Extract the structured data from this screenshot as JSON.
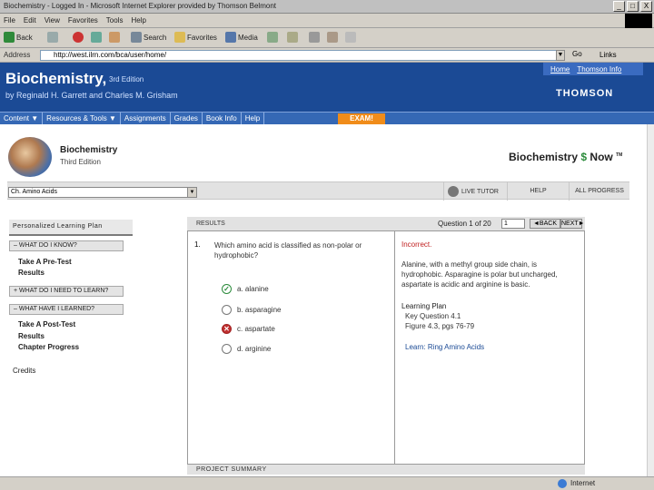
{
  "window": {
    "title": "Biochemistry - Logged In - Microsoft Internet Explorer provided by Thomson Belmont",
    "buttons": [
      "_",
      "□",
      "X"
    ]
  },
  "menubar": {
    "items": [
      "File",
      "Edit",
      "View",
      "Favorites",
      "Tools",
      "Help"
    ]
  },
  "toolbar": {
    "back": "Back",
    "search": "Search",
    "favorites": "Favorites",
    "media": "Media"
  },
  "address": {
    "label": "Address",
    "value": "http://west.ilrn.com/bca/user/home/",
    "go": "Go",
    "links": "Links"
  },
  "site": {
    "title": "Biochemistry,",
    "edition": "3rd Edition",
    "authors": "by Reginald H. Garrett and Charles M. Grisham",
    "top_links": [
      "Home",
      "Thomson Info"
    ],
    "brand": "THOMSON"
  },
  "nav": {
    "items": [
      "Content ▼",
      "Resources & Tools ▼",
      "Assignments",
      "Grades",
      "Book Info",
      "Help"
    ],
    "exam": "EXAM!"
  },
  "book": {
    "title": "Biochemistry",
    "edition": "Third Edition",
    "logo_left": "Biochemistry",
    "logo_right": "Now",
    "logo_tm": "TM"
  },
  "chapter_bar": {
    "selected": "Ch. Amino Acids",
    "live_tutor": "LIVE TUTOR",
    "help": "HELP",
    "all_progress": "ALL PROGRESS"
  },
  "left_nav": {
    "header": "Personalized Learning Plan",
    "sections": [
      {
        "label": "– WHAT DO I KNOW?",
        "links": [
          "Take A Pre-Test",
          "Results"
        ]
      },
      {
        "label": "+ WHAT DO I NEED TO LEARN?",
        "links": []
      },
      {
        "label": "– WHAT HAVE I LEARNED?",
        "links": [
          "Take A Post-Test",
          "Results",
          "Chapter Progress"
        ]
      }
    ],
    "credits": "Credits"
  },
  "results": {
    "header": "RESULTS",
    "question_count": "Question 1 of 20",
    "question_select": "1",
    "back": "◄BACK",
    "next": "NEXT►",
    "number": "1.",
    "question": "Which amino acid is classified as non-polar or hydrophobic?",
    "choices": [
      {
        "label": "a. alanine",
        "state": "correct"
      },
      {
        "label": "b. asparagine",
        "state": "none"
      },
      {
        "label": "c. aspartate",
        "state": "wrong"
      },
      {
        "label": "d. arginine",
        "state": "none"
      }
    ],
    "feedback_title": "Incorrect.",
    "feedback_text": "Alanine, with a methyl group side chain, is hydrophobic. Asparagine is polar but uncharged, aspartate is acidic and arginine is basic.",
    "plan_title": "Learning Plan",
    "plan_lines": [
      "Key Question 4.1",
      "Figure 4.3, pgs 76-79"
    ],
    "learn_link": "Learn: Ring Amino Acids",
    "summary": "PROJECT SUMMARY"
  },
  "status": {
    "zone": "Internet"
  },
  "colors": {
    "header_blue": "#1b4a95",
    "nav_blue": "#3568b5",
    "exam_orange": "#f08c1a",
    "incorrect_red": "#c02020",
    "correct_green": "#2a8a3a"
  }
}
